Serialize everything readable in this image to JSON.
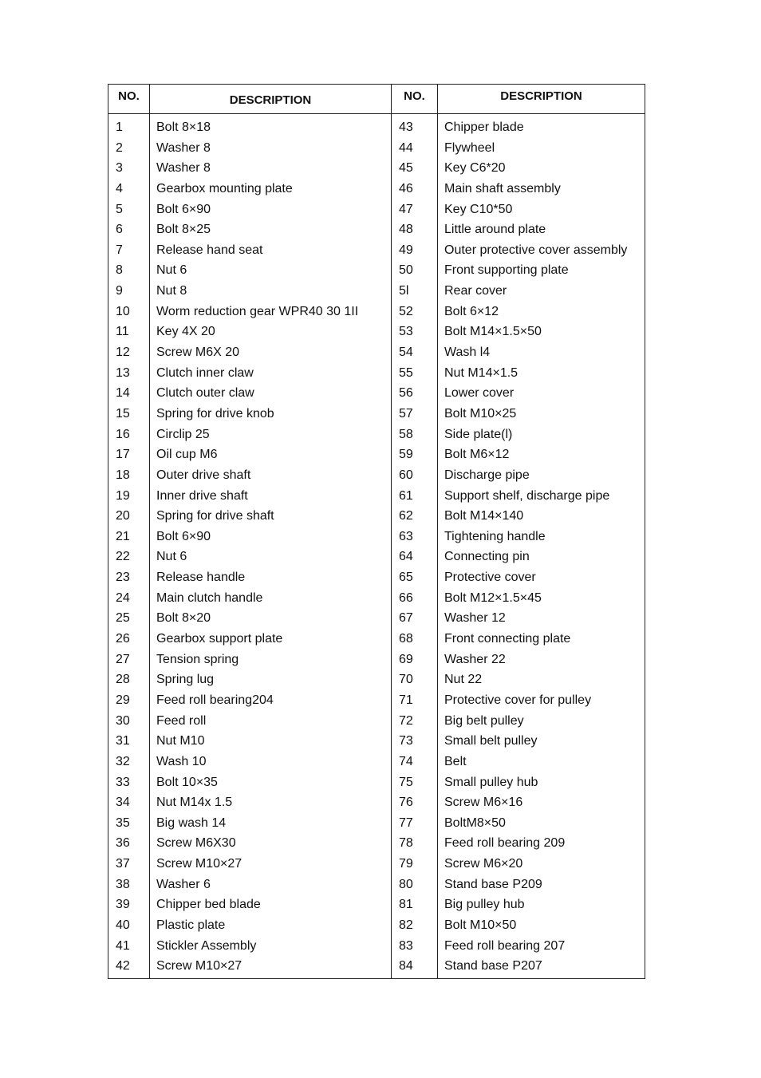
{
  "table": {
    "headers": {
      "no_left": "NO.",
      "desc_left": "DESCRIPTION",
      "no_right": "NO.",
      "desc_right": "DESCRIPTION"
    },
    "left": [
      {
        "no": "1",
        "desc": "Bolt 8×18"
      },
      {
        "no": "2",
        "desc": "Washer 8"
      },
      {
        "no": "3",
        "desc": "Washer 8"
      },
      {
        "no": "4",
        "desc": "Gearbox mounting plate"
      },
      {
        "no": "5",
        "desc": "Bolt 6×90"
      },
      {
        "no": "6",
        "desc": "Bolt 8×25"
      },
      {
        "no": "7",
        "desc": "Release hand seat"
      },
      {
        "no": "8",
        "desc": "Nut 6"
      },
      {
        "no": "9",
        "desc": "Nut 8"
      },
      {
        "no": "10",
        "desc": "Worm reduction gear WPR40   30   1II"
      },
      {
        "no": "11",
        "desc": "Key 4X 20"
      },
      {
        "no": "12",
        "desc": "Screw M6X 20"
      },
      {
        "no": "13",
        "desc": "Clutch inner claw"
      },
      {
        "no": "14",
        "desc": "Clutch outer claw"
      },
      {
        "no": "15",
        "desc": "Spring for drive knob"
      },
      {
        "no": "16",
        "desc": "Circlip 25"
      },
      {
        "no": "17",
        "desc": "Oil cup M6"
      },
      {
        "no": "18",
        "desc": "Outer drive shaft"
      },
      {
        "no": "19",
        "desc": "Inner drive shaft"
      },
      {
        "no": "20",
        "desc": "Spring for drive shaft"
      },
      {
        "no": "21",
        "desc": "Bolt 6×90"
      },
      {
        "no": "22",
        "desc": "Nut 6"
      },
      {
        "no": "23",
        "desc": "Release handle"
      },
      {
        "no": "24",
        "desc": "Main clutch handle"
      },
      {
        "no": "25",
        "desc": "Bolt 8×20"
      },
      {
        "no": "26",
        "desc": "Gearbox support plate"
      },
      {
        "no": "27",
        "desc": "Tension spring"
      },
      {
        "no": "28",
        "desc": "Spring lug"
      },
      {
        "no": "29",
        "desc": "Feed roll bearing204"
      },
      {
        "no": "30",
        "desc": "Feed roll"
      },
      {
        "no": "31",
        "desc": "Nut M10"
      },
      {
        "no": "32",
        "desc": "Wash 10"
      },
      {
        "no": "33",
        "desc": "Bolt 10×35"
      },
      {
        "no": "34",
        "desc": "Nut M14x 1.5"
      },
      {
        "no": "35",
        "desc": "Big wash 14"
      },
      {
        "no": "36",
        "desc": "Screw M6X30"
      },
      {
        "no": "37",
        "desc": "Screw M10×27"
      },
      {
        "no": "38",
        "desc": "Washer 6"
      },
      {
        "no": "39",
        "desc": "Chipper bed blade"
      },
      {
        "no": "40",
        "desc": "Plastic plate"
      },
      {
        "no": "41",
        "desc": "Stickler Assembly"
      },
      {
        "no": "42",
        "desc": "Screw M10×27"
      }
    ],
    "right": [
      {
        "no": "43",
        "desc": "Chipper blade"
      },
      {
        "no": "44",
        "desc": "Flywheel"
      },
      {
        "no": "45",
        "desc": "Key C6*20"
      },
      {
        "no": "46",
        "desc": "Main shaft assembly"
      },
      {
        "no": "47",
        "desc": "Key C10*50"
      },
      {
        "no": "48",
        "desc": "Little around plate"
      },
      {
        "no": "49",
        "desc": "Outer protective cover assembly"
      },
      {
        "no": "50",
        "desc": "Front supporting plate"
      },
      {
        "no": "5l",
        "desc": "Rear cover"
      },
      {
        "no": "52",
        "desc": "Bolt 6×12"
      },
      {
        "no": "53",
        "desc": "Bolt M14×1.5×50"
      },
      {
        "no": "54",
        "desc": "Wash l4"
      },
      {
        "no": "55",
        "desc": "Nut M14×1.5"
      },
      {
        "no": "56",
        "desc": "Lower cover"
      },
      {
        "no": "57",
        "desc": "Bolt M10×25"
      },
      {
        "no": "58",
        "desc": "Side plate(l)"
      },
      {
        "no": "59",
        "desc": "Bolt M6×12"
      },
      {
        "no": "60",
        "desc": "Discharge pipe"
      },
      {
        "no": "61",
        "desc": "Support shelf, discharge pipe"
      },
      {
        "no": "62",
        "desc": "Bolt M14×140"
      },
      {
        "no": "63",
        "desc": "Tightening handle"
      },
      {
        "no": "64",
        "desc": "Connecting pin"
      },
      {
        "no": "65",
        "desc": "Protective cover"
      },
      {
        "no": "66",
        "desc": "Bolt M12×1.5×45"
      },
      {
        "no": "67",
        "desc": "Washer 12"
      },
      {
        "no": "68",
        "desc": "Front connecting plate"
      },
      {
        "no": "69",
        "desc": "Washer 22"
      },
      {
        "no": "70",
        "desc": "Nut 22"
      },
      {
        "no": "71",
        "desc": "Protective cover for pulley"
      },
      {
        "no": "72",
        "desc": "Big belt pulley"
      },
      {
        "no": "73",
        "desc": "Small belt pulley"
      },
      {
        "no": "74",
        "desc": "Belt"
      },
      {
        "no": "75",
        "desc": "Small pulley hub"
      },
      {
        "no": "76",
        "desc": "Screw M6×16"
      },
      {
        "no": "77",
        "desc": "BoltM8×50"
      },
      {
        "no": "78",
        "desc": "Feed roll bearing 209"
      },
      {
        "no": "79",
        "desc": "Screw M6×20"
      },
      {
        "no": "80",
        "desc": "Stand base P209"
      },
      {
        "no": "81",
        "desc": "Big pulley hub"
      },
      {
        "no": "82",
        "desc": "Bolt M10×50"
      },
      {
        "no": "83",
        "desc": "Feed roll bearing 207"
      },
      {
        "no": "84",
        "desc": "Stand base P207"
      }
    ]
  }
}
